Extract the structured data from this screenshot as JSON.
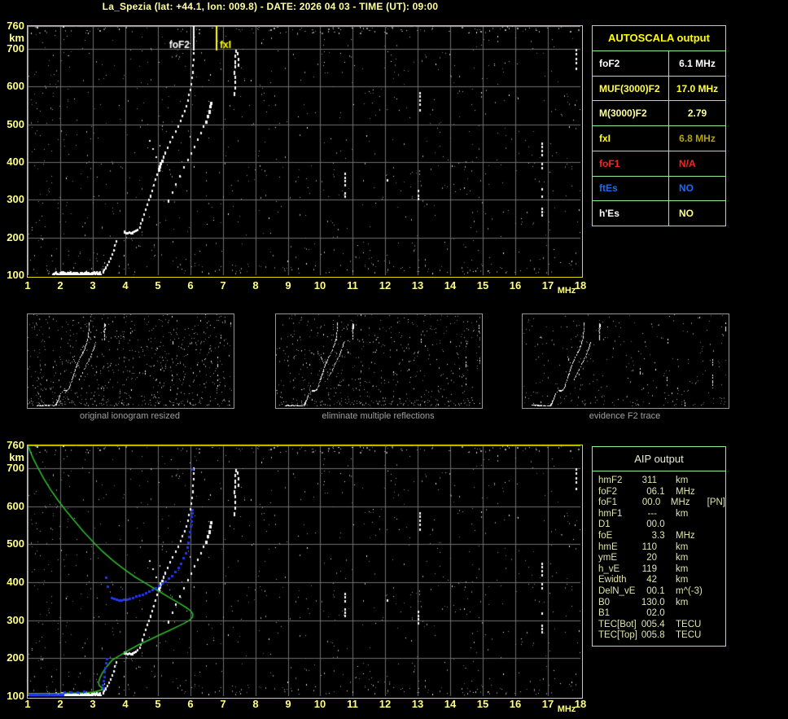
{
  "header": {
    "title": "La_Spezia (lat: +44.1, lon: 009.8) - DATE: 2026 04 03 - TIME (UT): 09:00"
  },
  "colors": {
    "title_yellow": "#ffffa0",
    "axis_yellow": "#ffff85",
    "chart_border_yellow": "#dede00",
    "grid_gray": "#6f6f6f",
    "table_border_green": "#90ee90",
    "trace_white": "#ffffff",
    "profile_green": "#2eb82e",
    "restored_trace_blue": "#2436f0",
    "caption_gray": "#a0a0a0"
  },
  "autoscala_table": {
    "title": "AUTOSCALA output",
    "rows": [
      {
        "label": "foF2",
        "value": "6.1 MHz",
        "label_color": "#ffffff",
        "value_color": "#ffffff",
        "value_align": "center"
      },
      {
        "label": "MUF(3000)F2",
        "value": "17.0 MHz",
        "label_color": "#ffff44",
        "value_color": "#ffff44",
        "value_align": "center"
      },
      {
        "label": "M(3000)F2",
        "value": "2.79",
        "label_color": "#ffffa0",
        "value_color": "#ffffa0",
        "value_align": "center"
      },
      {
        "label": "fxI",
        "value": "6.8 MHz",
        "label_color": "#ffff00",
        "value_color": "#b2a600",
        "value_align": "center"
      },
      {
        "label": "foF1",
        "value": "N/A",
        "label_color": "#ff2222",
        "value_color": "#ff2222",
        "value_align": "left"
      },
      {
        "label": "ftEs",
        "value": "NO",
        "label_color": "#1a6aff",
        "value_color": "#1a6aff",
        "value_align": "left"
      },
      {
        "label": "h'Es",
        "value": "NO",
        "label_color": "#ffffff",
        "value_color": "#ffff88",
        "value_align": "left"
      }
    ]
  },
  "aip_table": {
    "title": "AIP output",
    "rows": [
      {
        "label": "hmF2",
        "value": "311",
        "unit": "km",
        "extra": ""
      },
      {
        "label": "foF2",
        "value": "06.1",
        "unit": "MHz",
        "extra": ""
      },
      {
        "label": "foF1",
        "value": "00.0",
        "unit": "MHz",
        "extra": "[PN]"
      },
      {
        "label": "hmF1",
        "value": "---",
        "unit": "km",
        "extra": ""
      },
      {
        "label": "D1",
        "value": "00.0",
        "unit": "",
        "extra": ""
      },
      {
        "label": "foE",
        "value": "3.3",
        "unit": "MHz",
        "extra": ""
      },
      {
        "label": "hmE",
        "value": "110",
        "unit": "km",
        "extra": ""
      },
      {
        "label": "ymE",
        "value": "20",
        "unit": "km",
        "extra": ""
      },
      {
        "label": "h_vE",
        "value": "119",
        "unit": "km",
        "extra": ""
      },
      {
        "label": "Ewidth",
        "value": "42",
        "unit": "km",
        "extra": ""
      },
      {
        "label": "DelN_vE",
        "value": "00.1",
        "unit": "m^(-3)",
        "extra": ""
      },
      {
        "label": "B0",
        "value": "130.0",
        "unit": "km",
        "extra": ""
      },
      {
        "label": "B1",
        "value": "02.0",
        "unit": "",
        "extra": ""
      },
      {
        "label": "TEC[Bot]",
        "value": "005.4",
        "unit": "TECU",
        "extra": ""
      },
      {
        "label": "TEC[Top]",
        "value": "005.8",
        "unit": "TECU",
        "extra": ""
      }
    ]
  },
  "thumbnails": [
    {
      "caption": "original ionogram resized"
    },
    {
      "caption": "eliminate multiple reflections"
    },
    {
      "caption": "evidence F2 trace"
    }
  ],
  "chart_data": [
    {
      "id": "main-ionogram",
      "type": "scatter",
      "title": "ionogram with autoscaled characteristics",
      "xlabel": "MHz",
      "ylabel": "km",
      "xlim": [
        1,
        18
      ],
      "ylim": [
        100,
        760
      ],
      "grid": true,
      "x_ticks": [
        1,
        2,
        3,
        4,
        5,
        6,
        7,
        8,
        9,
        10,
        11,
        12,
        13,
        14,
        15,
        16,
        17,
        18
      ],
      "y_ticks": [
        760,
        700,
        600,
        500,
        400,
        300,
        200,
        100
      ],
      "markers": [
        {
          "label": "foF2",
          "freq_mhz": 6.1,
          "color": "#ffffff"
        },
        {
          "label": "fxI",
          "freq_mhz": 6.8,
          "color": "#ffff00"
        }
      ],
      "e_trace": {
        "f_start": 1.75,
        "f_end": 3.25,
        "h_km": 107
      },
      "o_trace": [
        [
          3.3,
          113
        ],
        [
          3.34,
          118
        ],
        [
          3.38,
          124
        ],
        [
          3.42,
          131
        ],
        [
          3.47,
          139
        ],
        [
          3.52,
          148
        ],
        [
          3.57,
          158
        ],
        [
          3.62,
          169
        ],
        [
          3.66,
          181
        ],
        [
          3.7,
          192
        ],
        [
          3.95,
          218
        ],
        [
          4.0,
          215
        ],
        [
          4.05,
          214
        ],
        [
          4.1,
          216
        ],
        [
          4.15,
          214
        ],
        [
          4.2,
          216
        ],
        [
          4.25,
          218
        ],
        [
          4.3,
          220
        ],
        [
          4.35,
          224
        ],
        [
          4.42,
          230
        ],
        [
          4.45,
          240
        ],
        [
          4.5,
          252
        ],
        [
          4.55,
          264
        ],
        [
          4.6,
          277
        ],
        [
          4.65,
          290
        ],
        [
          4.7,
          302
        ],
        [
          4.75,
          314
        ],
        [
          4.8,
          327
        ],
        [
          4.85,
          341
        ],
        [
          4.9,
          356
        ],
        [
          4.95,
          370
        ],
        [
          5.0,
          384
        ],
        [
          5.03,
          392
        ],
        [
          5.06,
          399
        ],
        [
          5.1,
          407
        ],
        [
          5.15,
          417
        ],
        [
          5.2,
          427
        ],
        [
          5.28,
          441
        ],
        [
          5.36,
          455
        ],
        [
          5.44,
          469
        ],
        [
          5.52,
          483
        ],
        [
          5.6,
          497
        ],
        [
          5.68,
          511
        ],
        [
          5.74,
          524
        ],
        [
          5.8,
          537
        ],
        [
          5.85,
          551
        ],
        [
          5.9,
          565
        ],
        [
          5.94,
          580
        ],
        [
          5.98,
          595
        ],
        [
          6.0,
          610
        ],
        [
          6.03,
          626
        ],
        [
          6.05,
          642
        ],
        [
          6.06,
          658
        ],
        [
          6.07,
          674
        ],
        [
          6.08,
          690
        ],
        [
          6.08,
          703
        ]
      ],
      "x_trace": [
        [
          5.3,
          300
        ],
        [
          5.42,
          322
        ],
        [
          5.54,
          344
        ],
        [
          5.66,
          366
        ],
        [
          5.78,
          388
        ],
        [
          5.9,
          408
        ],
        [
          6.0,
          426
        ],
        [
          6.1,
          444
        ],
        [
          6.2,
          462
        ],
        [
          6.3,
          480
        ],
        [
          6.38,
          496
        ],
        [
          6.45,
          510
        ],
        [
          6.5,
          524
        ],
        [
          6.55,
          538
        ],
        [
          6.58,
          550
        ],
        [
          6.6,
          560
        ],
        [
          7.34,
          585
        ],
        [
          7.36,
          600
        ],
        [
          7.35,
          615
        ],
        [
          7.37,
          629
        ],
        [
          7.33,
          642
        ],
        [
          7.35,
          656
        ],
        [
          7.36,
          670
        ],
        [
          7.37,
          684
        ],
        [
          7.38,
          698
        ],
        [
          7.45,
          660
        ],
        [
          7.46,
          676
        ],
        [
          7.44,
          692
        ]
      ],
      "cusp_trace": [
        [
          4.72,
          458
        ],
        [
          4.82,
          436
        ],
        [
          4.92,
          414
        ]
      ],
      "noise_streaks": [
        [
          13.05,
          525,
          585
        ],
        [
          13.0,
          294,
          326
        ],
        [
          10.75,
          308,
          372
        ],
        [
          16.8,
          252,
          330
        ],
        [
          16.8,
          383,
          458
        ],
        [
          14.5,
          113,
          132
        ],
        [
          17.85,
          640,
          700
        ],
        [
          9.6,
          214,
          224
        ],
        [
          12.05,
          352,
          366
        ]
      ]
    },
    {
      "id": "aip-ionogram",
      "type": "scatter",
      "title": "ionogram with AIP restored profile",
      "xlabel": "MHz",
      "ylabel": "km",
      "xlim": [
        1,
        18
      ],
      "ylim": [
        100,
        760
      ],
      "grid": true,
      "x_ticks": [
        1,
        2,
        3,
        4,
        5,
        6,
        7,
        8,
        9,
        10,
        11,
        12,
        13,
        14,
        15,
        16,
        17,
        18
      ],
      "y_ticks": [
        760,
        700,
        600,
        500,
        400,
        300,
        200,
        100
      ],
      "echo_same_as_chart_0": true,
      "green_profile": [
        [
          1.02,
          758
        ],
        [
          1.08,
          744
        ],
        [
          1.18,
          724
        ],
        [
          1.32,
          700
        ],
        [
          1.5,
          672
        ],
        [
          1.7,
          644
        ],
        [
          1.93,
          616
        ],
        [
          2.18,
          588
        ],
        [
          2.45,
          560
        ],
        [
          2.72,
          533
        ],
        [
          3.0,
          507
        ],
        [
          3.3,
          481
        ],
        [
          3.62,
          457
        ],
        [
          3.95,
          435
        ],
        [
          4.3,
          414
        ],
        [
          4.65,
          396
        ],
        [
          5.0,
          378
        ],
        [
          5.35,
          360
        ],
        [
          5.65,
          345
        ],
        [
          5.88,
          333
        ],
        [
          6.02,
          324
        ],
        [
          6.08,
          316
        ],
        [
          6.07,
          308
        ],
        [
          5.98,
          300
        ],
        [
          5.82,
          292
        ],
        [
          5.6,
          283
        ],
        [
          5.33,
          272
        ],
        [
          5.03,
          260
        ],
        [
          4.73,
          248
        ],
        [
          4.43,
          236
        ],
        [
          4.13,
          222
        ],
        [
          3.85,
          208
        ],
        [
          3.6,
          195
        ],
        [
          3.45,
          180
        ],
        [
          3.3,
          162
        ],
        [
          3.22,
          148
        ],
        [
          3.18,
          136
        ],
        [
          3.2,
          128
        ],
        [
          3.3,
          121
        ],
        [
          3.25,
          116
        ],
        [
          3.05,
          111
        ],
        [
          2.8,
          109
        ],
        [
          2.4,
          108
        ],
        [
          1.8,
          107
        ],
        [
          1.3,
          107
        ],
        [
          1.0,
          107
        ]
      ],
      "blue_trace": [
        [
          3.55,
          362
        ],
        [
          3.62,
          359
        ],
        [
          3.7,
          357
        ],
        [
          3.78,
          356
        ],
        [
          3.86,
          356
        ],
        [
          3.94,
          357
        ],
        [
          4.02,
          358
        ],
        [
          4.1,
          360
        ],
        [
          4.2,
          362
        ],
        [
          4.3,
          365
        ],
        [
          4.4,
          368
        ],
        [
          4.5,
          371
        ],
        [
          4.6,
          375
        ],
        [
          4.7,
          379
        ],
        [
          4.8,
          383
        ],
        [
          4.9,
          388
        ],
        [
          5.0,
          393
        ],
        [
          5.1,
          399
        ],
        [
          5.2,
          405
        ],
        [
          5.3,
          412
        ],
        [
          5.4,
          420
        ],
        [
          5.5,
          429
        ],
        [
          5.6,
          440
        ],
        [
          5.68,
          452
        ],
        [
          5.76,
          466
        ],
        [
          5.82,
          480
        ],
        [
          5.87,
          494
        ],
        [
          5.91,
          508
        ],
        [
          5.94,
          522
        ],
        [
          5.96,
          536
        ],
        [
          5.98,
          550
        ],
        [
          6.0,
          563
        ],
        [
          6.01,
          575
        ],
        [
          6.02,
          585
        ]
      ],
      "blue_extra": [
        [
          6.04,
          700
        ],
        [
          6.03,
          592
        ],
        [
          3.38,
          415
        ],
        [
          3.44,
          392
        ],
        [
          3.3,
          124
        ],
        [
          3.28,
          132
        ],
        [
          3.3,
          142
        ],
        [
          3.32,
          154
        ],
        [
          3.33,
          166
        ],
        [
          3.35,
          178
        ],
        [
          3.37,
          190
        ],
        [
          3.4,
          200
        ],
        [
          2.1,
          112
        ],
        [
          2.3,
          112
        ],
        [
          2.5,
          113
        ],
        [
          2.7,
          114
        ]
      ],
      "blue_hline": {
        "f_start": 1.02,
        "f_end": 2.05,
        "h_km": 105
      }
    }
  ]
}
